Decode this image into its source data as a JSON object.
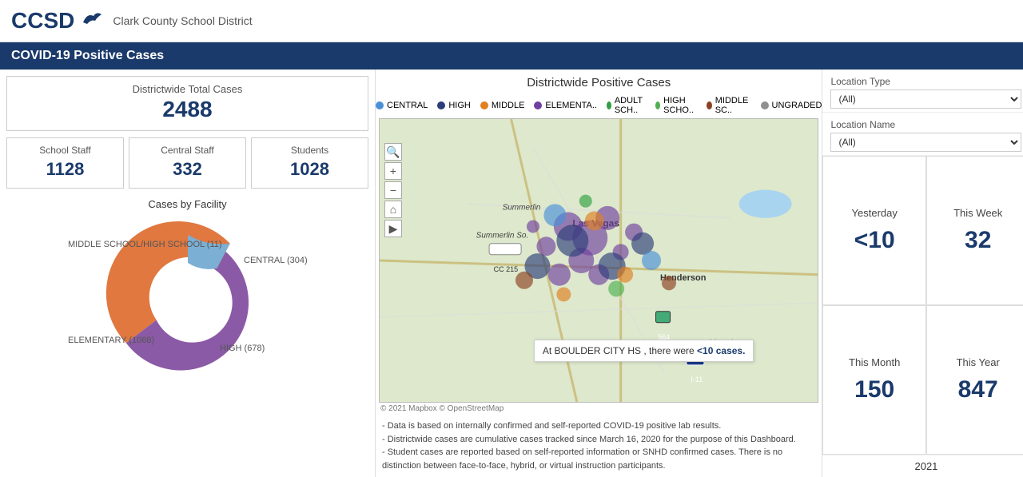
{
  "header": {
    "logo": "CCSD",
    "logo_bird": "🦅",
    "district_name": "Clark County School District"
  },
  "title_bar": {
    "label": "COVID-19 Positive Cases"
  },
  "totals": {
    "total_label": "Districtwide Total Cases",
    "total_value": "2488",
    "school_staff_label": "School Staff",
    "school_staff_value": "1128",
    "central_staff_label": "Central Staff",
    "central_staff_value": "332",
    "students_label": "Students",
    "students_value": "1028"
  },
  "facility_chart": {
    "title": "Cases by Facility",
    "segments": [
      {
        "label": "ELEMENTARY (1068)",
        "value": 1068,
        "color": "#8b5aa6"
      },
      {
        "label": "HIGH (678)",
        "value": 678,
        "color": "#e07840"
      },
      {
        "label": "CENTRAL (304)",
        "value": 304,
        "color": "#7bafd4"
      },
      {
        "label": "MIDDLE SCHOOL/HIGH SCHOOL (11)",
        "value": 11,
        "color": "#c0c0d0"
      }
    ]
  },
  "map": {
    "title": "Districtwide Positive Cases",
    "legend": [
      {
        "label": "CENTRAL",
        "color": "#4a90d9"
      },
      {
        "label": "HIGH",
        "color": "#2c3e7a"
      },
      {
        "label": "MIDDLE",
        "color": "#e08020"
      },
      {
        "label": "ELEMENTA..",
        "color": "#7040a0"
      },
      {
        "label": "ADULT SCH..",
        "color": "#30a040"
      },
      {
        "label": "HIGH SCHO..",
        "color": "#50b050"
      },
      {
        "label": "MIDDLE SC..",
        "color": "#8b4020"
      },
      {
        "label": "UNGRADED",
        "color": "#909090"
      }
    ],
    "footer": "© 2021 Mapbox © OpenStreetMap",
    "tooltip": "At BOULDER CITY HS , there were <10 cases.",
    "notes": [
      "- Data is based on internally confirmed and self-reported COVID-19 positive lab results.",
      "- Districtwide cases are cumulative cases tracked since March 16, 2020 for the purpose of this Dashboard.",
      "- Student cases are reported based on self-reported information or SNHD confirmed cases. There is no distinction between face-to-face, hybrid, or virtual instruction participants."
    ]
  },
  "filters": {
    "location_type_label": "Location Type",
    "location_type_value": "(All)",
    "location_name_label": "Location Name",
    "location_name_value": "(All)"
  },
  "time_stats": {
    "yesterday_label": "Yesterday",
    "yesterday_value": "<10",
    "this_week_label": "This Week",
    "this_week_value": "32",
    "this_month_label": "This Month",
    "this_month_value": "150",
    "this_year_label": "This Year",
    "this_year_value": "847",
    "year_label": "2021"
  }
}
